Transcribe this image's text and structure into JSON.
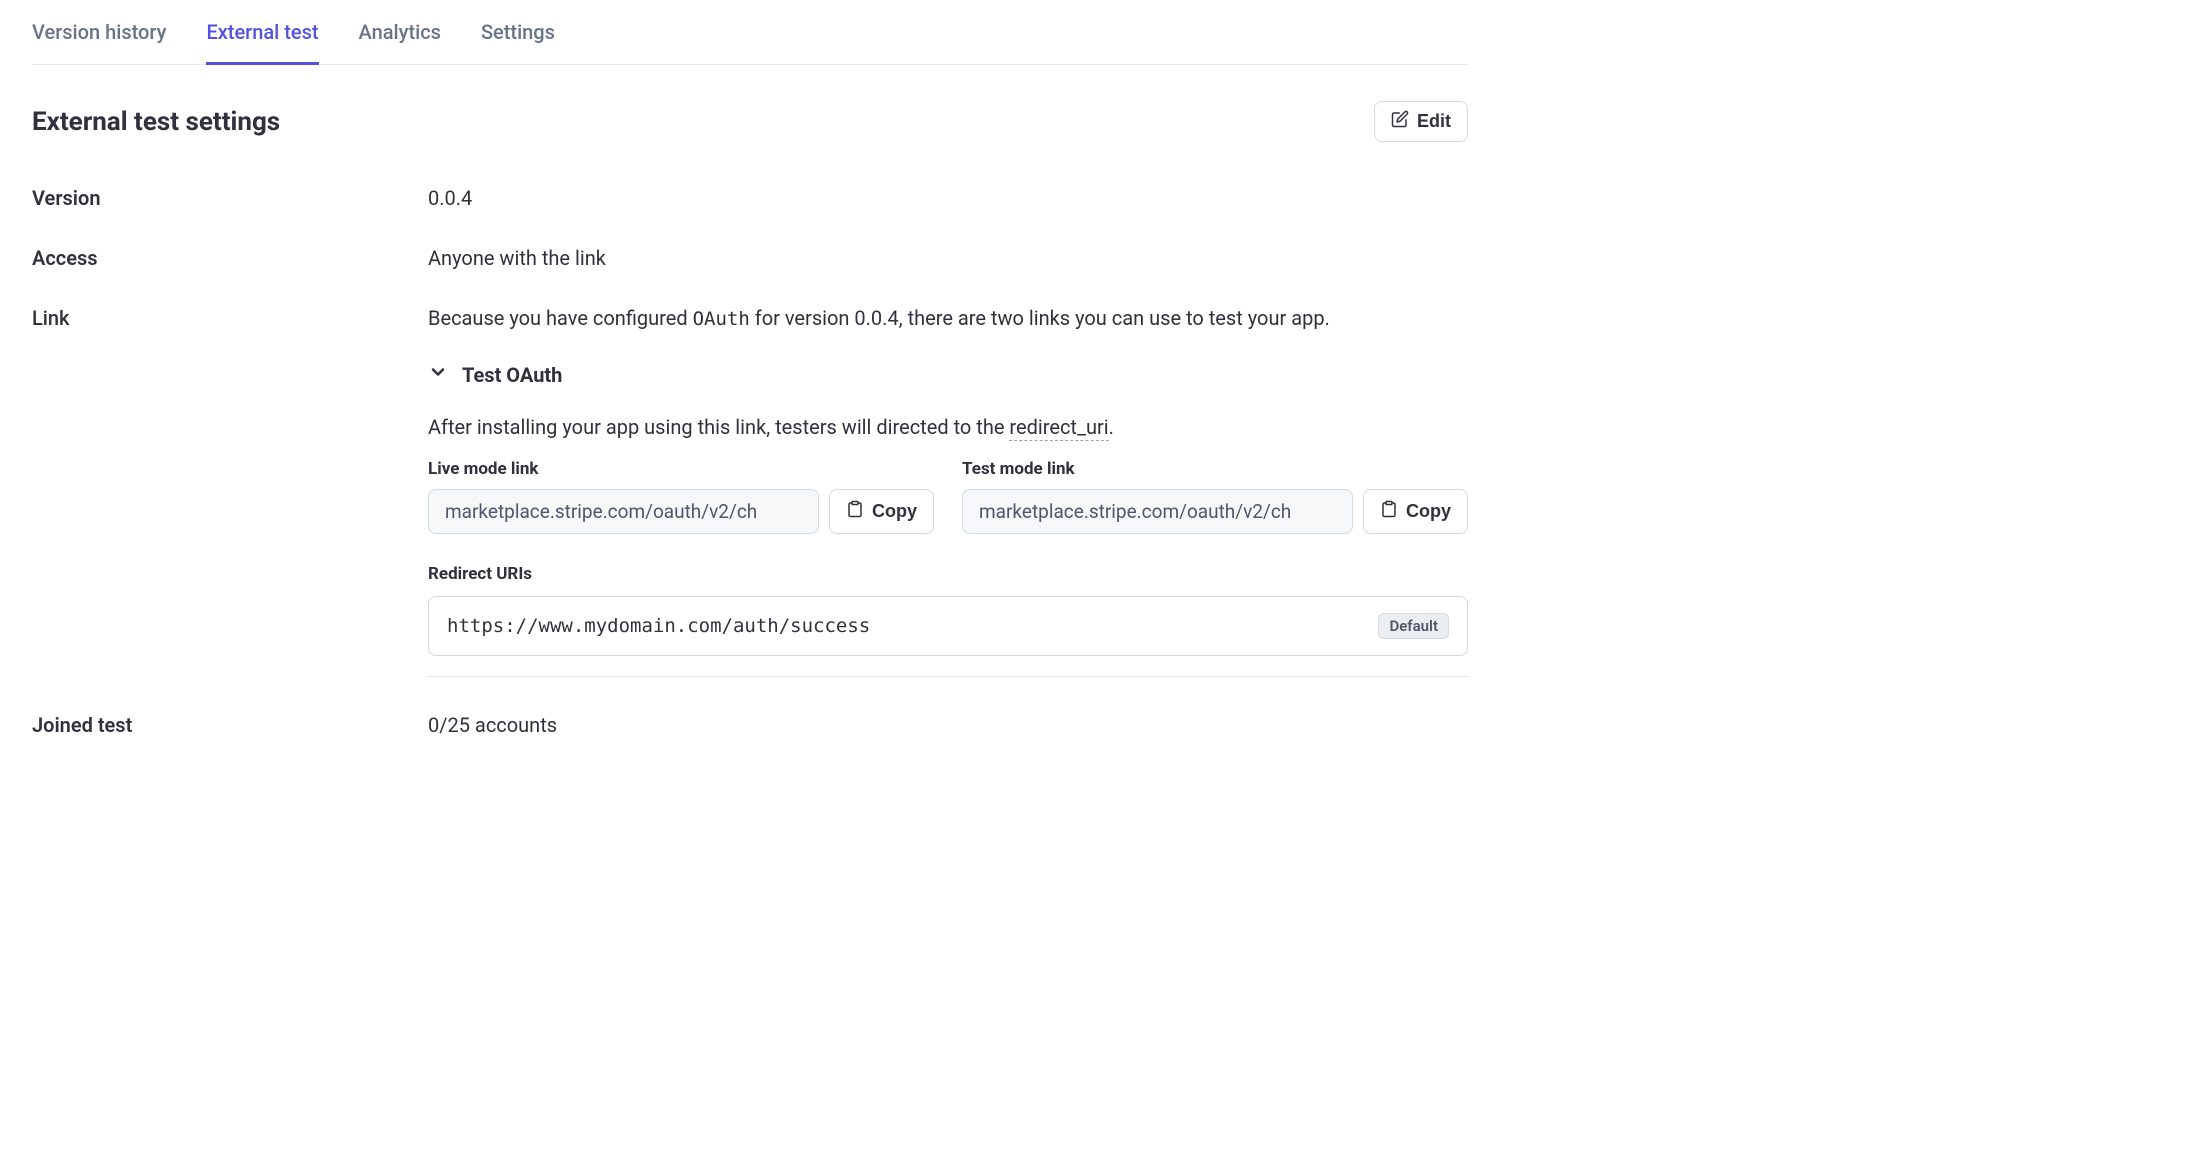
{
  "tabs": [
    {
      "label": "Version history"
    },
    {
      "label": "External test"
    },
    {
      "label": "Analytics"
    },
    {
      "label": "Settings"
    }
  ],
  "activeTabIndex": 1,
  "header": {
    "title": "External test settings",
    "editLabel": "Edit"
  },
  "rows": {
    "version": {
      "label": "Version",
      "value": "0.0.4"
    },
    "access": {
      "label": "Access",
      "value": "Anyone with the link"
    },
    "link": {
      "label": "Link",
      "description_pre": "Because you have configured ",
      "description_code": "OAuth",
      "description_post": " for version 0.0.4, there are two links you can use to test your app.",
      "expand_title": "Test OAuth",
      "oauth_desc_pre": "After installing your app using this link, testers will directed to the ",
      "oauth_desc_term": "redirect_uri",
      "oauth_desc_post": ".",
      "live_mode_label": "Live mode link",
      "live_mode_url": "marketplace.stripe.com/oauth/v2/ch",
      "test_mode_label": "Test mode link",
      "test_mode_url": "marketplace.stripe.com/oauth/v2/ch",
      "copy_label": "Copy",
      "redirect_label": "Redirect URIs",
      "redirect_url": "https://www.mydomain.com/auth/success",
      "default_badge": "Default"
    },
    "joined": {
      "label": "Joined test",
      "value": "0/25 accounts"
    }
  }
}
